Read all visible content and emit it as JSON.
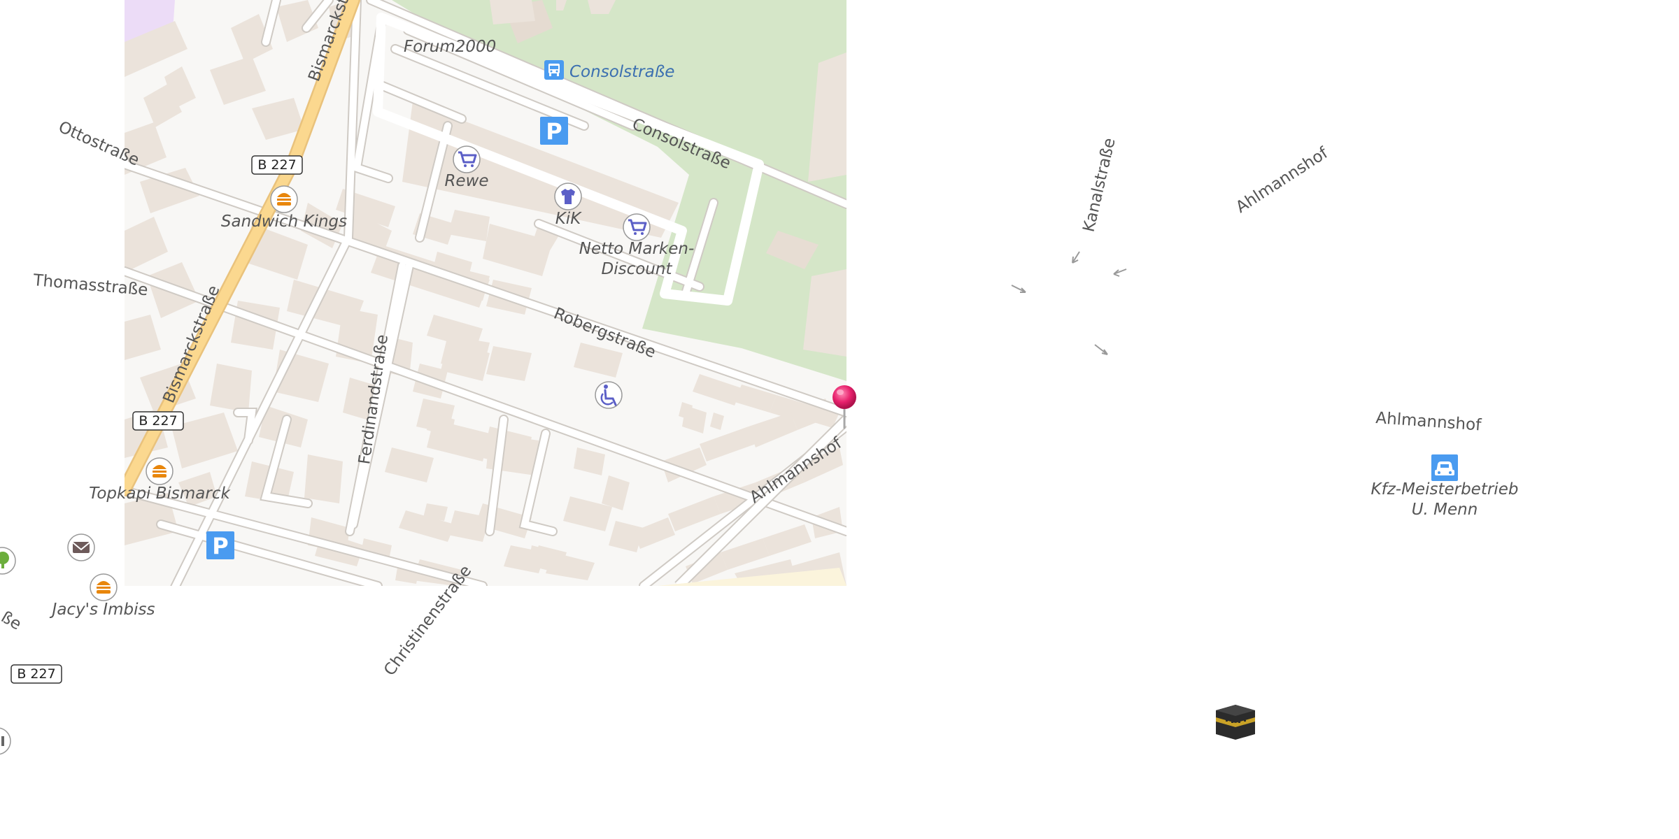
{
  "map": {
    "streets": {
      "bismarckstrasse_top": "Bismarckstraße",
      "bismarckstrasse": "Bismarckstraße",
      "ottostrasse": "Ottostraße",
      "thomasstrasse": "Thomasstraße",
      "consolstrasse": "Consolstraße",
      "robergstrasse": "Robergstraße",
      "ferdinandstrasse": "Ferdinandstraße",
      "ahlmannshof_road": "Ahlmannshof",
      "christinenstrasse": "Christinenstraße",
      "kanalstrasse": "Kanalstraße",
      "ahlmannshof_diag": "Ahlmannshof",
      "ahlmannshof_label": "Ahlmannshof",
      "partial_se": "ße"
    },
    "road_shields": {
      "b227_top": "B 227",
      "b227_mid": "B 227",
      "b227_bottom": "B 227"
    },
    "pois": {
      "forum": "Forum2000",
      "bus_stop": "Consolstraße",
      "rewe": "Rewe",
      "kik": "KiK",
      "netto_line1": "Netto Marken-",
      "netto_line2": "Discount",
      "sandwich": "Sandwich Kings",
      "topkapi": "Topkapi Bismarck",
      "jacys": "Jacy's Imbiss",
      "kfz_line1": "Kfz-Meisterbetrieb",
      "kfz_line2": "U. Menn"
    },
    "icons": {
      "parking_letter_1": "P",
      "parking_letter_2": "P"
    },
    "colors": {
      "land": "#f8f7f5",
      "park": "#d5e6c8",
      "building": "#ebe3db",
      "main_road": "#fbd88f",
      "parking_blue": "#4a9bf0",
      "poi_blue": "#5b5fc7",
      "food_orange": "#e8860c",
      "pin": "#e8226d"
    }
  }
}
